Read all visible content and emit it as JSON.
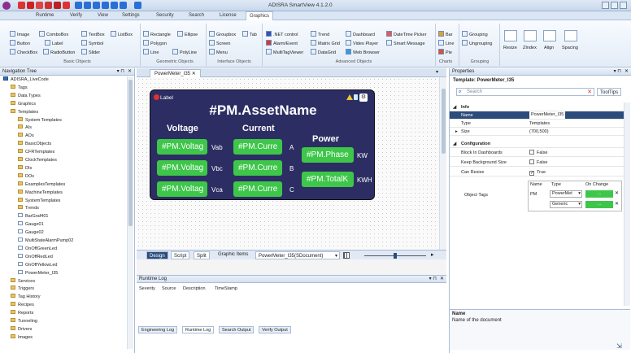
{
  "app": {
    "title": "ADISRA SmartView 4.1.2.0"
  },
  "window_controls": [
    "- ",
    "▫",
    "✕"
  ],
  "menu": [
    "Runtime",
    "Verify",
    "View",
    "Settings",
    "Security",
    "Search",
    "License",
    "Graphics"
  ],
  "ribbon": {
    "basic": [
      "Image",
      "ComboBox",
      "TextBox",
      "ListBox",
      "Button",
      "Label",
      "Symbol",
      "CheckBox",
      "RadioButton",
      "Slider"
    ],
    "basic_group": "Basic Objects",
    "geometric": [
      "Rectangle",
      "Ellipse",
      "Polygon",
      "Line",
      "PolyLine"
    ],
    "geometric_group": "Geometric Objects",
    "interface": [
      "Groupbox",
      "Tab",
      "Screen",
      "Menu"
    ],
    "interface_group": "Interface Objects",
    "advanced": [
      ".NET control",
      "Trend",
      "Dashboard",
      "DateTime Picker",
      "Alarm/Event",
      "Matrix Grid",
      "Video Player",
      "Smart Message",
      "MultiTagViewer",
      "DataGrid",
      "Web Browser"
    ],
    "advanced_group": "Advanced Objects",
    "charts": [
      "Bar",
      "Line",
      "Pie"
    ],
    "charts_group": "Charts",
    "grouping": [
      "Grouping",
      "Ungrouping"
    ],
    "grouping_group": "Grouping",
    "layout": [
      "Resize",
      "ZIndex",
      "Align",
      "Spacing"
    ]
  },
  "nav": {
    "title": "Navigation Tree",
    "items": [
      {
        "label": "ADISRA_LiveCode",
        "level": 0,
        "icon": "project"
      },
      {
        "label": "Tags",
        "level": 1,
        "icon": "folder"
      },
      {
        "label": "Data Types",
        "level": 1,
        "icon": "folder"
      },
      {
        "label": "Graphics",
        "level": 1,
        "icon": "folder"
      },
      {
        "label": "Templates",
        "level": 1,
        "icon": "folder"
      },
      {
        "label": "System Templates",
        "level": 2,
        "icon": "folder"
      },
      {
        "label": "AIs",
        "level": 2,
        "icon": "folder"
      },
      {
        "label": "AOs",
        "level": 2,
        "icon": "folder"
      },
      {
        "label": "BasicObjects",
        "level": 2,
        "icon": "folder"
      },
      {
        "label": "CFRTemplates",
        "level": 2,
        "icon": "folder"
      },
      {
        "label": "ClockTemplates",
        "level": 2,
        "icon": "folder"
      },
      {
        "label": "DIs",
        "level": 2,
        "icon": "folder"
      },
      {
        "label": "DOs",
        "level": 2,
        "icon": "folder"
      },
      {
        "label": "ExamplesTemplates",
        "level": 2,
        "icon": "folder"
      },
      {
        "label": "MachineTemplates",
        "level": 2,
        "icon": "folder"
      },
      {
        "label": "SystemTemplates",
        "level": 2,
        "icon": "folder"
      },
      {
        "label": "Trends",
        "level": 2,
        "icon": "folder"
      },
      {
        "label": "BarGraf401",
        "level": 2,
        "icon": "doc"
      },
      {
        "label": "Gauge01",
        "level": 2,
        "icon": "doc"
      },
      {
        "label": "Gauge02",
        "level": 2,
        "icon": "doc"
      },
      {
        "label": "MultiStateAlarmPump02",
        "level": 2,
        "icon": "doc"
      },
      {
        "label": "OnOffGreenLed",
        "level": 2,
        "icon": "doc"
      },
      {
        "label": "OnOffRedLed",
        "level": 2,
        "icon": "doc"
      },
      {
        "label": "OnOffYellowLed",
        "level": 2,
        "icon": "doc"
      },
      {
        "label": "PowerMeter_I35",
        "level": 2,
        "icon": "doc"
      },
      {
        "label": "Services",
        "level": 1,
        "icon": "folder"
      },
      {
        "label": "Triggers",
        "level": 1,
        "icon": "folder"
      },
      {
        "label": "Tag History",
        "level": 1,
        "icon": "folder"
      },
      {
        "label": "Recipes",
        "level": 1,
        "icon": "folder"
      },
      {
        "label": "Reports",
        "level": 1,
        "icon": "folder"
      },
      {
        "label": "Tunneling",
        "level": 1,
        "icon": "folder"
      },
      {
        "label": "Drivers",
        "level": 1,
        "icon": "folder"
      },
      {
        "label": "Images",
        "level": 1,
        "icon": "folder"
      }
    ]
  },
  "doc_tab": {
    "label": "PowerMeter_I35"
  },
  "template": {
    "label_badge": "Label",
    "title": "#PM.AssetName",
    "voltage": "Voltage",
    "current": "Current",
    "power": "Power",
    "v_tags": [
      "#PM.Voltag",
      "#PM.Voltag",
      "#PM.Voltag"
    ],
    "v_units": [
      "Vab",
      "Vbc",
      "Vca"
    ],
    "c_tags": [
      "#PM.Curre",
      "#PM.Curre",
      "#PM.Curre"
    ],
    "c_units": [
      "A",
      "B",
      "C"
    ],
    "p_tags": [
      "#PM.Phase",
      "#PM.TotalK"
    ],
    "p_units": [
      "KW",
      "KWH"
    ]
  },
  "design_bar": {
    "design": "Design",
    "script": "Script",
    "split": "Split",
    "graphic_items": "Graphic Items",
    "selector": "PowerMeter_I35(SDocument)"
  },
  "props": {
    "title": "Properties",
    "template_line": "Template: PowerMeter_I35",
    "search_placeholder": "Search",
    "tooltips": "ToolTips",
    "info_section": "Info",
    "name_label": "Name",
    "name_value": "PowerMeter_I35",
    "type_label": "Type",
    "type_value": "Templates",
    "size_label": "Size",
    "size_value": "(700,500)",
    "config_section": "Configuration",
    "block_label": "Block In Dashboards",
    "block_value": "False",
    "keep_label": "Keep Background Size",
    "keep_value": "False",
    "resize_label": "Can Resize",
    "resize_value": "True",
    "tags_label": "Object Tags",
    "tags_cols": [
      "Name",
      "Type",
      "On Change"
    ],
    "tags_rows": [
      {
        "name": "PM",
        "type": "PowerMet",
        "change": "..."
      },
      {
        "name": "",
        "type": "Generic",
        "change": "..."
      }
    ],
    "desc_title": "Name",
    "desc_text": "Name of the document"
  },
  "log": {
    "title": "Runtime Log",
    "columns": [
      "Severity",
      "Source",
      "Description",
      "TimeStamp"
    ],
    "tabs": [
      "Engineering Log",
      "Runtime Log",
      "Search Output",
      "Verify Output"
    ]
  },
  "colors": {
    "accent": "#3ec64a",
    "template_bg": "#2c2e63",
    "chrome": "#dbe6f4"
  }
}
